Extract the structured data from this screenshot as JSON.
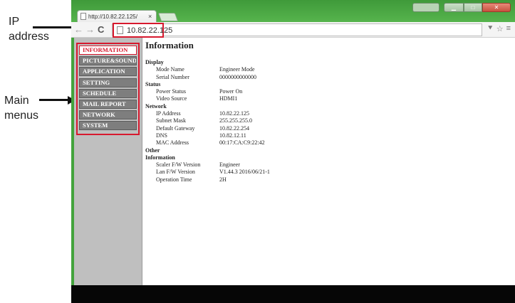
{
  "annotations": {
    "ip_address": [
      "IP",
      "address"
    ],
    "main_menus": [
      "Main",
      "menus"
    ]
  },
  "browser": {
    "tab_title": "http://10.82.22.125/",
    "tab_close": "×",
    "url": "10.82.22.125",
    "accent_color": "#4aa843",
    "highlight_color": "#d7192e"
  },
  "toolbar_icons": [
    "filter-icon",
    "star-icon",
    "menu-icon"
  ],
  "sidebar": {
    "items": [
      {
        "label": "INFORMATION",
        "active": true
      },
      {
        "label": "PICTURE&SOUND",
        "active": false
      },
      {
        "label": "APPLICATION",
        "active": false
      },
      {
        "label": "SETTING",
        "active": false
      },
      {
        "label": "SCHEDULE",
        "active": false
      },
      {
        "label": "MAIL REPORT",
        "active": false
      },
      {
        "label": "NETWORK",
        "active": false
      },
      {
        "label": "SYSTEM",
        "active": false
      }
    ]
  },
  "main": {
    "title": "Information",
    "sections": [
      {
        "heading": "Display",
        "rows": [
          {
            "label": "Mode Name",
            "value": "Engineer Mode"
          },
          {
            "label": "Serial Number",
            "value": "0000000000000"
          }
        ]
      },
      {
        "heading": "Status",
        "rows": [
          {
            "label": "Power Status",
            "value": "Power On"
          },
          {
            "label": "Video Source",
            "value": "HDMI1"
          }
        ]
      },
      {
        "heading": "Network",
        "rows": [
          {
            "label": "IP Address",
            "value": "10.82.22.125"
          },
          {
            "label": "Subnet Mask",
            "value": "255.255.255.0"
          },
          {
            "label": "Default Gateway",
            "value": "10.82.22.254"
          },
          {
            "label": "DNS",
            "value": "10.82.12.11"
          },
          {
            "label": "MAC Address",
            "value": "00:17:CA:C9:22:42"
          }
        ]
      },
      {
        "heading": "Other",
        "rows": []
      },
      {
        "heading": "Information",
        "rows": [
          {
            "label": "Scaler F/W Version",
            "value": "Engineer"
          },
          {
            "label": "Lan F/W Version",
            "value": "V1.44.3 2016/06/21-1"
          },
          {
            "label": "Operation Time",
            "value": "2H"
          }
        ]
      }
    ]
  }
}
